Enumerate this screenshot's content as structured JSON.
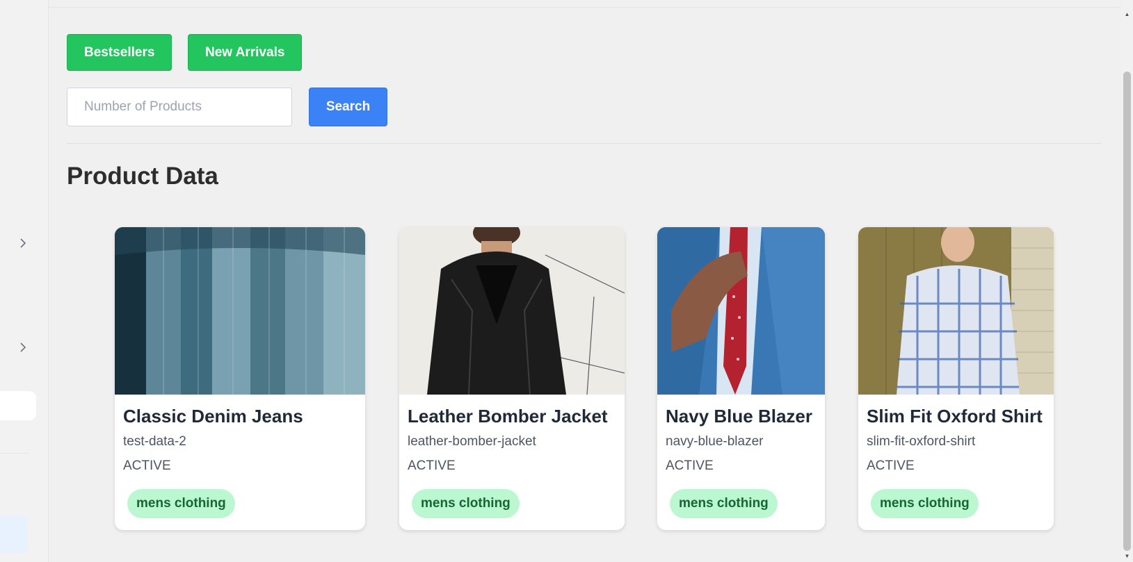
{
  "filters": {
    "bestsellers_label": "Bestsellers",
    "new_arrivals_label": "New Arrivals"
  },
  "search": {
    "placeholder": "Number of Products",
    "value": "",
    "button_label": "Search"
  },
  "section": {
    "title": "Product Data"
  },
  "products": [
    {
      "name": "Classic Denim Jeans",
      "slug": "test-data-2",
      "status": "ACTIVE",
      "tag": "mens clothing",
      "image": "denim-jeans-photo"
    },
    {
      "name": "Leather Bomber Jacket",
      "slug": "leather-bomber-jacket",
      "status": "ACTIVE",
      "tag": "mens clothing",
      "image": "leather-jacket-photo"
    },
    {
      "name": "Navy Blue Blazer",
      "slug": "navy-blue-blazer",
      "status": "ACTIVE",
      "tag": "mens clothing",
      "image": "navy-blazer-photo"
    },
    {
      "name": "Slim Fit Oxford Shirt",
      "slug": "slim-fit-oxford-shirt",
      "status": "ACTIVE",
      "tag": "mens clothing",
      "image": "oxford-shirt-photo"
    }
  ],
  "colors": {
    "accent_green": "#22c55e",
    "accent_blue": "#3b82f6",
    "tag_bg": "#bbf7d0",
    "tag_text": "#166534"
  },
  "icons": {
    "sidebar_chevron": "chevron-right-icon",
    "scroll_up": "scroll-up-arrow-icon",
    "scroll_down": "scroll-down-arrow-icon"
  }
}
